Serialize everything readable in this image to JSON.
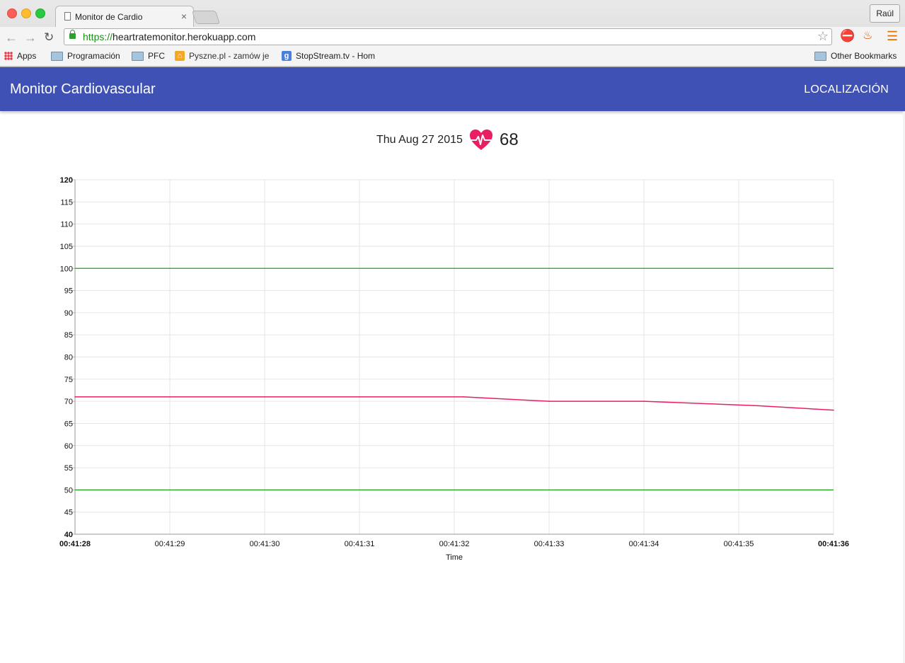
{
  "browser": {
    "tab_title": "Monitor de Cardio",
    "tab_close": "×",
    "user_button": "Raúl",
    "url_scheme": "https://",
    "url_host": "heartratemonitor.herokuapp.com",
    "bookmarks": [
      {
        "label": "Apps",
        "icon": "apps-grid-icon"
      },
      {
        "label": "Programación",
        "icon": "folder-icon"
      },
      {
        "label": "PFC",
        "icon": "folder-icon"
      },
      {
        "label": "Pyszne.pl - zamów je",
        "icon": "pyszne-favicon"
      },
      {
        "label": "StopStream.tv - Hom",
        "icon": "google-favicon"
      }
    ],
    "other_bookmarks": "Other Bookmarks"
  },
  "app": {
    "title": "Monitor Cardiovascular",
    "action": "LOCALIZACIÓN"
  },
  "status": {
    "date": "Thu Aug 27 2015",
    "bpm": "68",
    "heart_color": "#e91e63"
  },
  "chart_data": {
    "type": "line",
    "xlabel": "Time",
    "ylabel": "",
    "ylim": [
      40,
      120
    ],
    "yticks": [
      40,
      45,
      50,
      55,
      60,
      65,
      70,
      75,
      80,
      85,
      90,
      95,
      100,
      105,
      110,
      115,
      120
    ],
    "x": [
      "00:41:28",
      "00:41:29",
      "00:41:30",
      "00:41:31",
      "00:41:32",
      "00:41:33",
      "00:41:34",
      "00:41:35",
      "00:41:36"
    ],
    "x_ticks_bold": [
      "00:41:28",
      "00:41:36"
    ],
    "grid": true,
    "series": [
      {
        "values": [
          71,
          71,
          71,
          71,
          71,
          70,
          70,
          69,
          68
        ],
        "x_seconds": [
          0,
          1,
          2,
          3,
          4.1,
          5,
          6,
          7.2,
          8
        ],
        "color": "#e91e63"
      }
    ],
    "thresholds": [
      {
        "value": 100,
        "color": "#1aa51a"
      },
      {
        "value": 50,
        "color": "#1aa51a"
      }
    ]
  }
}
